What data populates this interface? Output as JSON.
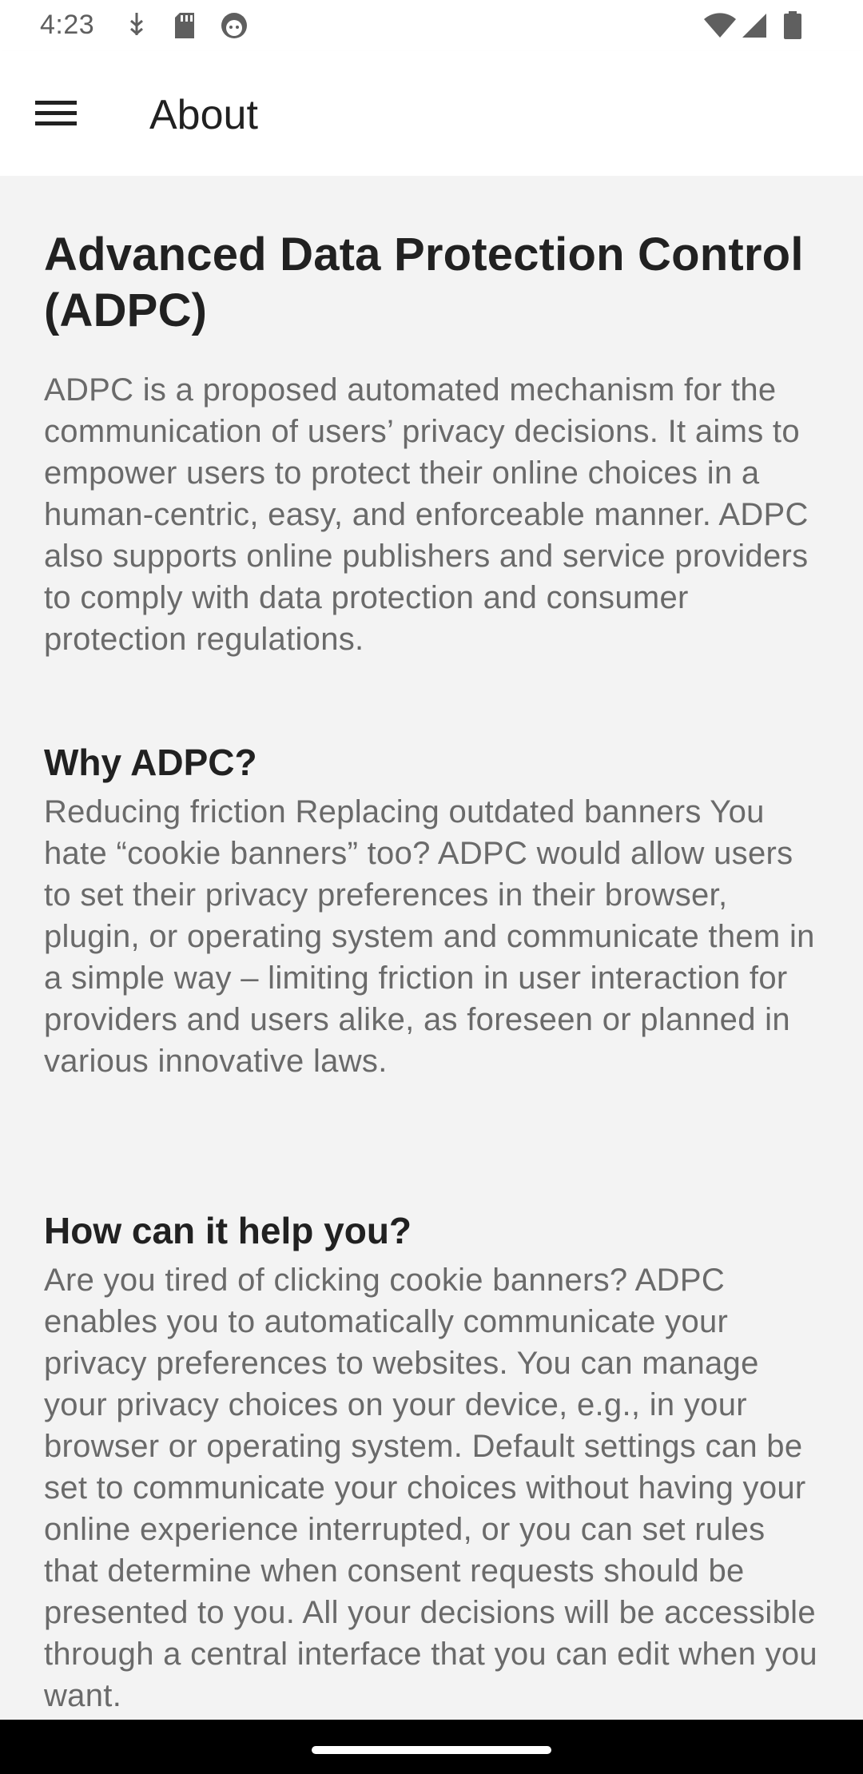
{
  "status_bar": {
    "time": "4:23",
    "left_icons": [
      "usb-debug-icon",
      "sd-card-icon",
      "android-icon"
    ],
    "right_icons": [
      "wifi-icon",
      "signal-icon",
      "battery-icon"
    ]
  },
  "app_bar": {
    "title": "About",
    "menu_icon": "hamburger-menu-icon"
  },
  "sections": [
    {
      "title": "Advanced Data Protection Control (ADPC)",
      "body": "ADPC is a proposed automated mechanism for the communication of users’ privacy decisions. It aims to empower users to protect their online choices in a human-centric, easy, and enforceable manner. ADPC also supports online publishers and service providers to comply with data protection and consumer protection regulations."
    },
    {
      "title": "Why ADPC?",
      "body": "Reducing friction Replacing outdated banners You hate “cookie banners” too? ADPC would allow users to set their privacy preferences in their browser, plugin, or operating system and communicate them in a simple way – limiting friction in user interaction for providers and users alike, as foreseen or planned in various innovative laws."
    },
    {
      "title": "How can it help you?",
      "body": "Are you tired of clicking cookie banners? ADPC enables you to automatically communicate your privacy preferences to websites. You can manage your privacy choices on your device, e.g., in your browser or operating system. Default settings can be set to communicate your choices without having your online experience interrupted, or you can set rules that determine when consent requests should be presented to you. All your decisions will be accessible through a central interface that you can edit when you want."
    }
  ],
  "colors": {
    "background": "#f3f3f3",
    "app_bar": "#ffffff",
    "heading_text": "#212121",
    "body_text": "#6a6a6a",
    "nav_bar": "#000000"
  }
}
